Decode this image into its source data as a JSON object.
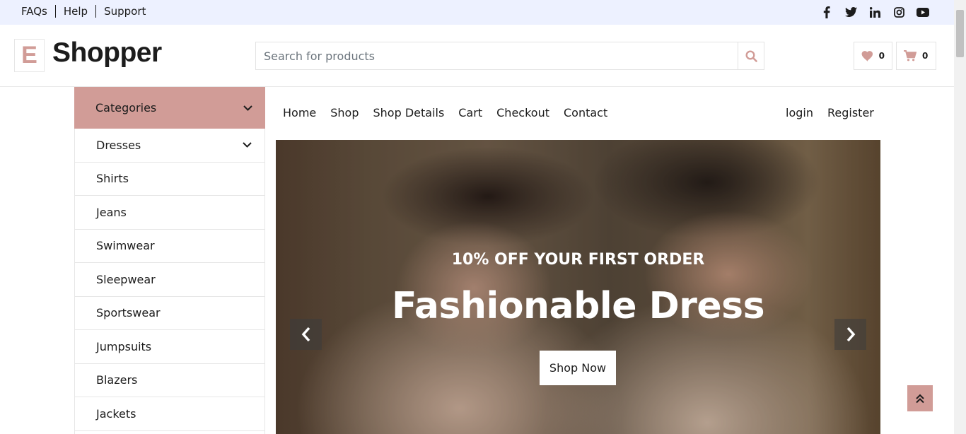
{
  "topbar": {
    "links": [
      "FAQs",
      "Help",
      "Support"
    ],
    "social_icons": [
      "facebook-icon",
      "twitter-icon",
      "linkedin-icon",
      "instagram-icon",
      "youtube-icon"
    ]
  },
  "header": {
    "logo_letter": "E",
    "logo_text": "Shopper",
    "search_placeholder": "Search for products",
    "wishlist_count": "0",
    "cart_count": "0"
  },
  "categories": {
    "title": "Categories",
    "items": [
      "Dresses",
      "Shirts",
      "Jeans",
      "Swimwear",
      "Sleepwear",
      "Sportswear",
      "Jumpsuits",
      "Blazers",
      "Jackets"
    ]
  },
  "nav": {
    "links": [
      "Home",
      "Shop",
      "Shop Details",
      "Cart",
      "Checkout",
      "Contact"
    ],
    "auth": [
      "login",
      "Register"
    ]
  },
  "hero": {
    "subtitle": "10% OFF YOUR FIRST ORDER",
    "title": "Fashionable Dress",
    "button": "Shop Now"
  },
  "colors": {
    "accent": "#d19c97",
    "topbar_bg": "#edf1ff",
    "text": "#1c1c1c"
  }
}
